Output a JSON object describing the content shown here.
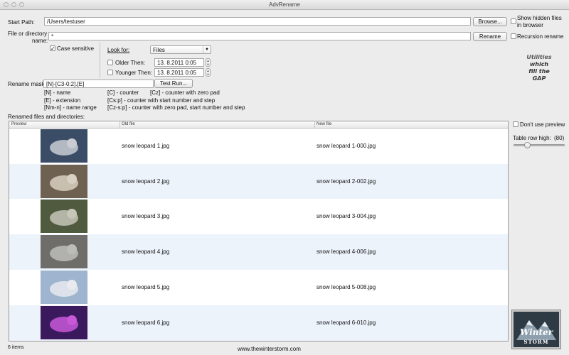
{
  "window": {
    "title": "AdvRename"
  },
  "form": {
    "start_path_label": "Start Path:",
    "start_path_value": "/Users/testuser",
    "browse_button": "Browse...",
    "show_hidden_label_line1": "Show hidden files",
    "show_hidden_label_line2": "in browser",
    "file_dir_label_line1": "File or directory",
    "file_dir_label_line2": "name:",
    "file_dir_value": "*",
    "rename_button": "Rename",
    "recursion_label": "Recursion rename",
    "case_sensitive_label": "Case sensitive",
    "case_sensitive_checked": true,
    "look_for_label": "Look for:",
    "look_for_value": "Files",
    "older_label": "Older Then:",
    "older_value": "13.  8.2011  0:05",
    "younger_label": "Younger Then:",
    "younger_value": "13.  8.2011  0:05",
    "rename_mask_label": "Rename mask:",
    "rename_mask_value": "[N]-[C3-0:2].[E]",
    "test_run_button": "Test Run..."
  },
  "legend": {
    "name": "[N] - name",
    "extension": "[E] - extension",
    "name_range": "[Nm-n] - name range",
    "counter": "[C] - counter",
    "counter_start": "[Cs:p] - counter with start number and step",
    "counter_zero_start": "[Cz-s:p] - counter with zero pad, start number and step",
    "counter_zero": "[Cz] - counter with zero pad"
  },
  "logo_text": {
    "line1": "Utilities",
    "line2": "which",
    "line3": "fill the",
    "line4": "GAP"
  },
  "table": {
    "caption": "Renamed files and directories:",
    "columns": [
      "Preview",
      "Old file",
      "New file"
    ],
    "rows": [
      {
        "old": "snow leopard 1.jpg",
        "new": "snow leopard 1-000.jpg",
        "thumb_bg": "#3b4c66",
        "thumb_fg": "#c9ccd2"
      },
      {
        "old": "snow leopard 2.jpg",
        "new": "snow leopard 2-002.jpg",
        "thumb_bg": "#6f6152",
        "thumb_fg": "#d8d0c2"
      },
      {
        "old": "snow leopard 3.jpg",
        "new": "snow leopard 3-004.jpg",
        "thumb_bg": "#4f5a3f",
        "thumb_fg": "#c6c6b9"
      },
      {
        "old": "snow leopard 4.jpg",
        "new": "snow leopard 4-006.jpg",
        "thumb_bg": "#6e6d6a",
        "thumb_fg": "#bdbdb8"
      },
      {
        "old": "snow leopard 5.jpg",
        "new": "snow leopard 5-008.jpg",
        "thumb_bg": "#9fb4cf",
        "thumb_fg": "#e8eaee"
      },
      {
        "old": "snow leopard 6.jpg",
        "new": "snow leopard 6-010.jpg",
        "thumb_bg": "#3a1a5c",
        "thumb_fg": "#c858d8"
      }
    ]
  },
  "side": {
    "dont_preview_label": "Don't use preview",
    "row_high_label": "Table row high:",
    "row_high_value": "(80)",
    "row_high_fraction": 0.25,
    "winter_logo_line1": "Winter",
    "winter_logo_line2": "STORM"
  },
  "status": {
    "items": "6 items",
    "website": "www.thewinterstorm.com"
  },
  "colors": {
    "row_alt": "#edf3fb",
    "row": "#ffffff",
    "logo_bg": "#2e3a44"
  }
}
